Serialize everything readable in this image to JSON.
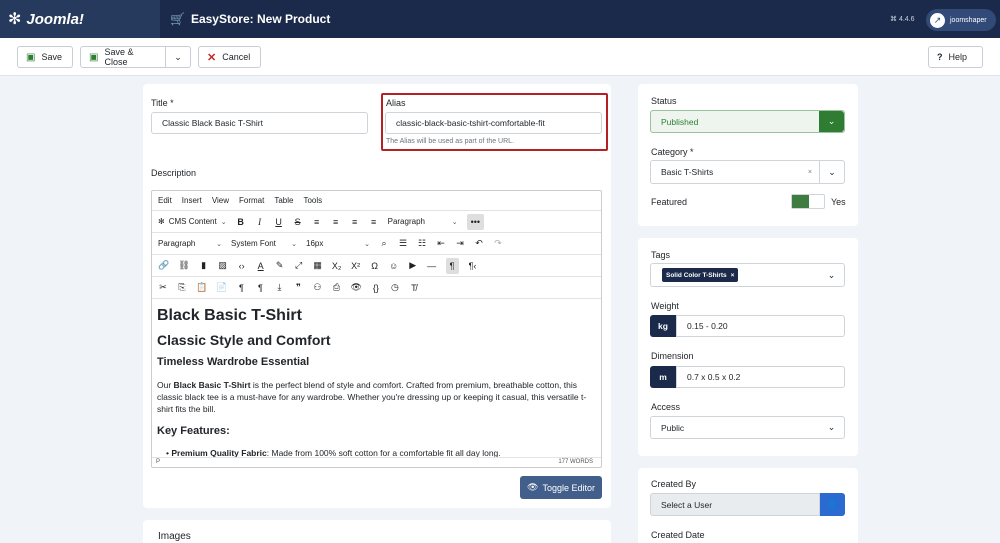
{
  "header": {
    "logo": "Joomla!",
    "page_title": "EasyStore: New Product",
    "version": "⌘ 4.4.6",
    "user": "joomshaper"
  },
  "toolbar": {
    "save": "Save",
    "save_close": "Save & Close",
    "cancel": "Cancel",
    "help": "Help"
  },
  "form": {
    "title_label": "Title *",
    "title_value": "Classic Black Basic T-Shirt",
    "alias_label": "Alias",
    "alias_value": "classic-black-basic-tshirt-comfortable-fit",
    "alias_hint": "The Alias will be used as part of the URL.",
    "description_label": "Description"
  },
  "editor": {
    "menu": [
      "Edit",
      "Insert",
      "View",
      "Format",
      "Table",
      "Tools"
    ],
    "cms_content": "CMS Content",
    "block_format": "Paragraph",
    "block_format2": "Paragraph",
    "font_family": "System Font",
    "font_size": "16px",
    "content": {
      "h1": "Black Basic T-Shirt",
      "h2": "Classic Style and Comfort",
      "h3": "Timeless Wardrobe Essential",
      "para_prefix": "Our ",
      "para_bold": "Black Basic T-Shirt",
      "para_rest": " is the perfect blend of style and comfort. Crafted from premium, breathable cotton, this classic black tee is a must-have for any wardrobe. Whether you're dressing up or keeping it casual, this versatile t-shirt fits the bill.",
      "h4": "Key Features:",
      "li_bold": "Premium Quality Fabric",
      "li_rest": ": Made from 100% soft cotton for a comfortable fit all day long."
    },
    "status_path": "P",
    "word_count": "177 WORDS",
    "toggle": "Toggle Editor"
  },
  "images_section": "Images",
  "sidebar": {
    "status_label": "Status",
    "status_value": "Published",
    "category_label": "Category *",
    "category_value": "Basic T-Shirts",
    "featured_label": "Featured",
    "featured_value": "Yes",
    "tags_label": "Tags",
    "tag_chip": "Solid Color T-Shirts",
    "weight_label": "Weight",
    "weight_unit": "kg",
    "weight_value": "0.15 - 0.20",
    "dimension_label": "Dimension",
    "dimension_unit": "m",
    "dimension_value": "0.7 x 0.5 x 0.2",
    "access_label": "Access",
    "access_value": "Public",
    "created_by_label": "Created By",
    "created_by_placeholder": "Select a User",
    "created_date_label": "Created Date"
  },
  "colors": {
    "header_bg": "#1b2a4a",
    "published_green": "#2f7d32",
    "toggle_btn": "#425f8c",
    "user_btn": "#2a6ad1",
    "alias_border": "#b32124"
  }
}
